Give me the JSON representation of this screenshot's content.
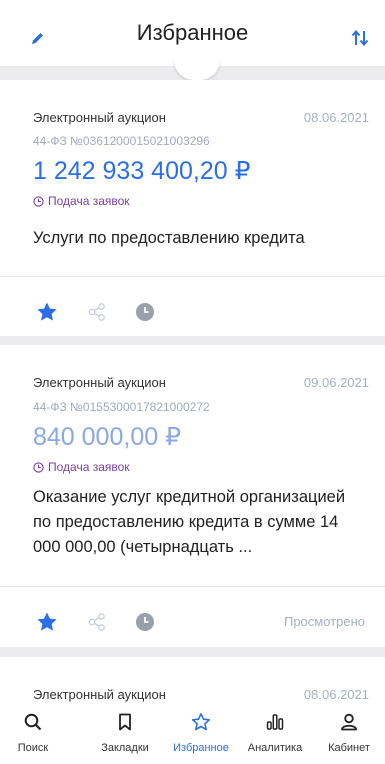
{
  "header": {
    "title": "Избранное",
    "edit_icon": "pencil-icon",
    "sort_icon": "sort-arrows-icon"
  },
  "colors": {
    "accent": "#2b6ee8",
    "price_viewed": "#8aa7e6",
    "status": "#7b3fa8",
    "muted": "#a8b0c0"
  },
  "cards": [
    {
      "type": "Электронный аукцион",
      "date": "08.06.2021",
      "number": "44-ФЗ №0361200015021003296",
      "price": "1 242 933 400,20 ₽",
      "status": "Подача заявок",
      "description": "Услуги по предоставлению кредита",
      "viewed": ""
    },
    {
      "type": "Электронный аукцион",
      "date": "09.06.2021",
      "number": "44-ФЗ №0155300017821000272",
      "price": "840 000,00 ₽",
      "status": "Подача заявок",
      "description": "Оказание услуг кредитной организацией по предоставлению кредита в сумме 14 000 000,00 (четырнадцать  ...",
      "viewed": "Просмотрено"
    },
    {
      "type": "Электронный аукцион",
      "date": "08.06.2021"
    }
  ],
  "tabbar": [
    {
      "label": "Поиск",
      "icon": "search-icon"
    },
    {
      "label": "Закладки",
      "icon": "bookmark-icon"
    },
    {
      "label": "Избранное",
      "icon": "star-icon",
      "active": true
    },
    {
      "label": "Аналитика",
      "icon": "analytics-icon"
    },
    {
      "label": "Кабинет",
      "icon": "person-icon"
    }
  ]
}
